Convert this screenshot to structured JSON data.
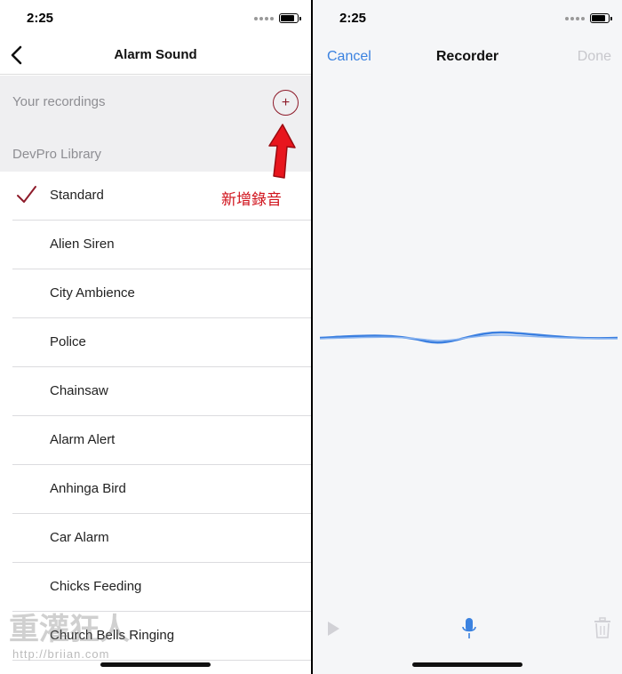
{
  "left": {
    "status_time": "2:25",
    "nav_title": "Alarm Sound",
    "recordings_label": "Your recordings",
    "add_symbol": "+",
    "library_label": "DevPro Library",
    "sounds": [
      {
        "name": "Standard",
        "selected": true
      },
      {
        "name": "Alien Siren",
        "selected": false
      },
      {
        "name": "City Ambience",
        "selected": false
      },
      {
        "name": "Police",
        "selected": false
      },
      {
        "name": "Chainsaw",
        "selected": false
      },
      {
        "name": "Alarm Alert",
        "selected": false
      },
      {
        "name": "Anhinga Bird",
        "selected": false
      },
      {
        "name": "Car Alarm",
        "selected": false
      },
      {
        "name": "Chicks Feeding",
        "selected": false
      },
      {
        "name": "Church Bells Ringing",
        "selected": false
      }
    ],
    "annotation": "新增錄音",
    "watermark_text": "重灌狂人",
    "watermark_url": "http://briian.com"
  },
  "right": {
    "status_time": "2:25",
    "cancel_label": "Cancel",
    "title": "Recorder",
    "done_label": "Done"
  },
  "colors": {
    "accent_red": "#8e1b2a",
    "annotation_red": "#d0121b",
    "ios_blue": "#3b82e0",
    "disabled_gray": "#c7c7cc"
  },
  "icons": [
    "back-chevron-icon",
    "plus-circle-icon",
    "checkmark-icon",
    "play-icon",
    "microphone-icon",
    "trash-icon",
    "battery-icon"
  ]
}
